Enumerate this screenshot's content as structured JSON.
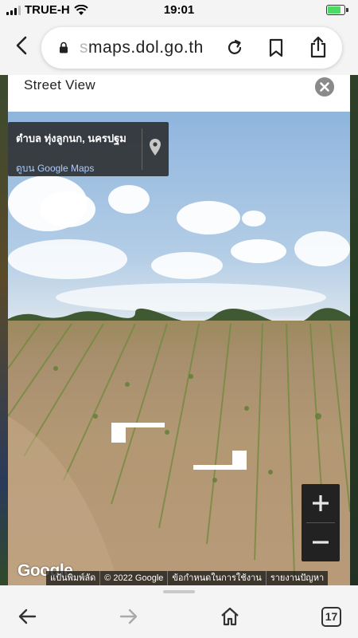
{
  "status_bar": {
    "carrier": "TRUE-H",
    "time": "19:01",
    "battery_percent": 85,
    "battery_color": "#4cd964"
  },
  "browser": {
    "url_faded": "s",
    "url_main": "maps.dol.go.th",
    "icons": [
      "back-icon",
      "lock-icon",
      "reload-icon",
      "bookmark-icon",
      "share-icon"
    ]
  },
  "street_view": {
    "title": "Street View",
    "location": "ตำบล ทุ่งลูกนก, นครปฐม",
    "link": "ดูบน Google Maps",
    "zoom_in_label": "+",
    "zoom_out_label": "−"
  },
  "attribution": {
    "logo": "Google",
    "items": [
      "แป้นพิมพ์ลัด",
      "© 2022 Google",
      "ข้อกำหนดในการใช้งาน",
      "รายงานปัญหา"
    ]
  },
  "toolbar": {
    "tabs_count": "17",
    "icons": [
      "back-arrow-icon",
      "forward-arrow-icon",
      "home-icon",
      "tabs-icon"
    ]
  },
  "colors": {
    "link": "#aecbfa",
    "card_bg": "#282828",
    "zoom_bg": "#222222"
  }
}
